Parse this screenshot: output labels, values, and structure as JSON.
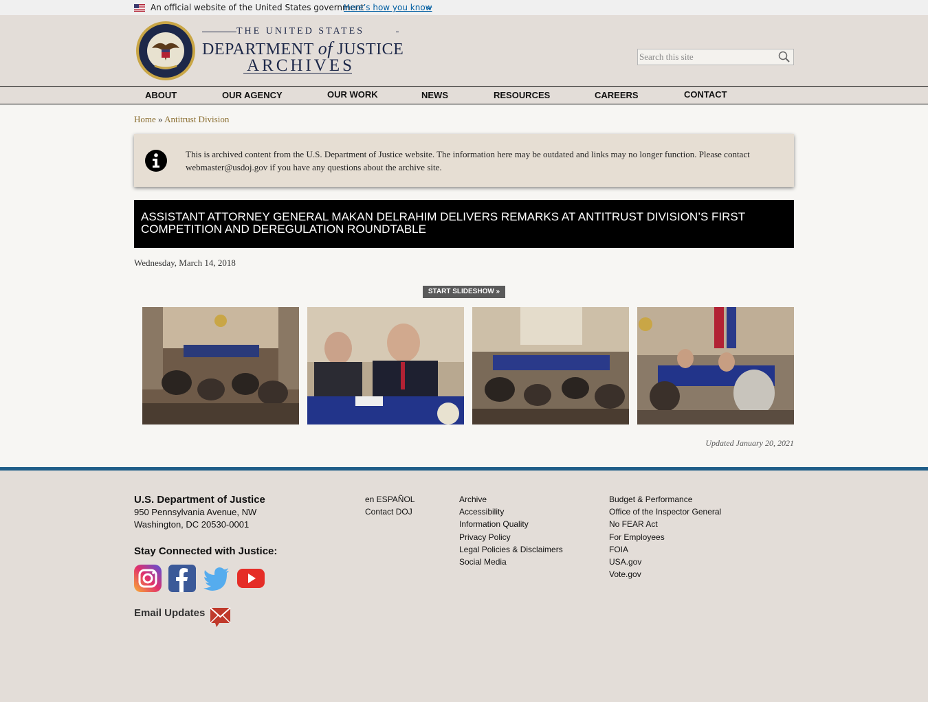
{
  "gov_banner": {
    "official_text": "An official website of the United States government",
    "how_you_know": "Here’s how you know"
  },
  "header": {
    "title_line1": "THE UNITED STATES",
    "title_department": "DEPARTMENT",
    "title_of": "of",
    "title_justice": "JUSTICE",
    "title_line3": "ARCHIVES",
    "search_placeholder": "Search this site"
  },
  "nav": {
    "items": [
      "ABOUT",
      "OUR AGENCY",
      "OUR WORK",
      "NEWS",
      "RESOURCES",
      "CAREERS",
      "CONTACT"
    ]
  },
  "breadcrumb": {
    "home": "Home",
    "separator": "»",
    "current": "Antitrust Division"
  },
  "notice": {
    "text": "This is archived content from the U.S. Department of Justice website. The information here may be outdated and links may no longer function. Please contact webmaster@usdoj.gov if you have any questions about the archive site."
  },
  "article": {
    "title": "ASSISTANT ATTORNEY GENERAL MAKAN DELRAHIM DELIVERS REMARKS AT ANTITRUST DIVISION’S FIRST COMPETITION AND DEREGULATION ROUNDTABLE",
    "date": "Wednesday, March 14, 2018",
    "slideshow_label": "START SLIDESHOW »",
    "updated": "Updated January 20, 2021"
  },
  "footer": {
    "org": "U.S. Department of Justice",
    "address1": "950 Pennsylvania Avenue, NW",
    "address2": "Washington, DC 20530-0001",
    "stay_connected": "Stay Connected with Justice:",
    "email_updates": "Email Updates",
    "col1": [
      "en ESPAÑOL",
      "Contact DOJ"
    ],
    "col2": [
      "Archive",
      "Accessibility",
      "Information Quality",
      "Privacy Policy",
      "Legal Policies & Disclaimers",
      "Social Media"
    ],
    "col3": [
      "Budget & Performance",
      "Office of the Inspector General",
      "No FEAR Act",
      "For Employees",
      "FOIA",
      "USA.gov",
      "Vote.gov"
    ]
  },
  "colors": {
    "page_bg": "#e3ddd8",
    "content_bg": "#f7f6f3",
    "link_gold": "#8a6d2f",
    "banner_link": "#005ea2",
    "footer_rule": "#1f5d88",
    "headline_bg": "#000000"
  }
}
